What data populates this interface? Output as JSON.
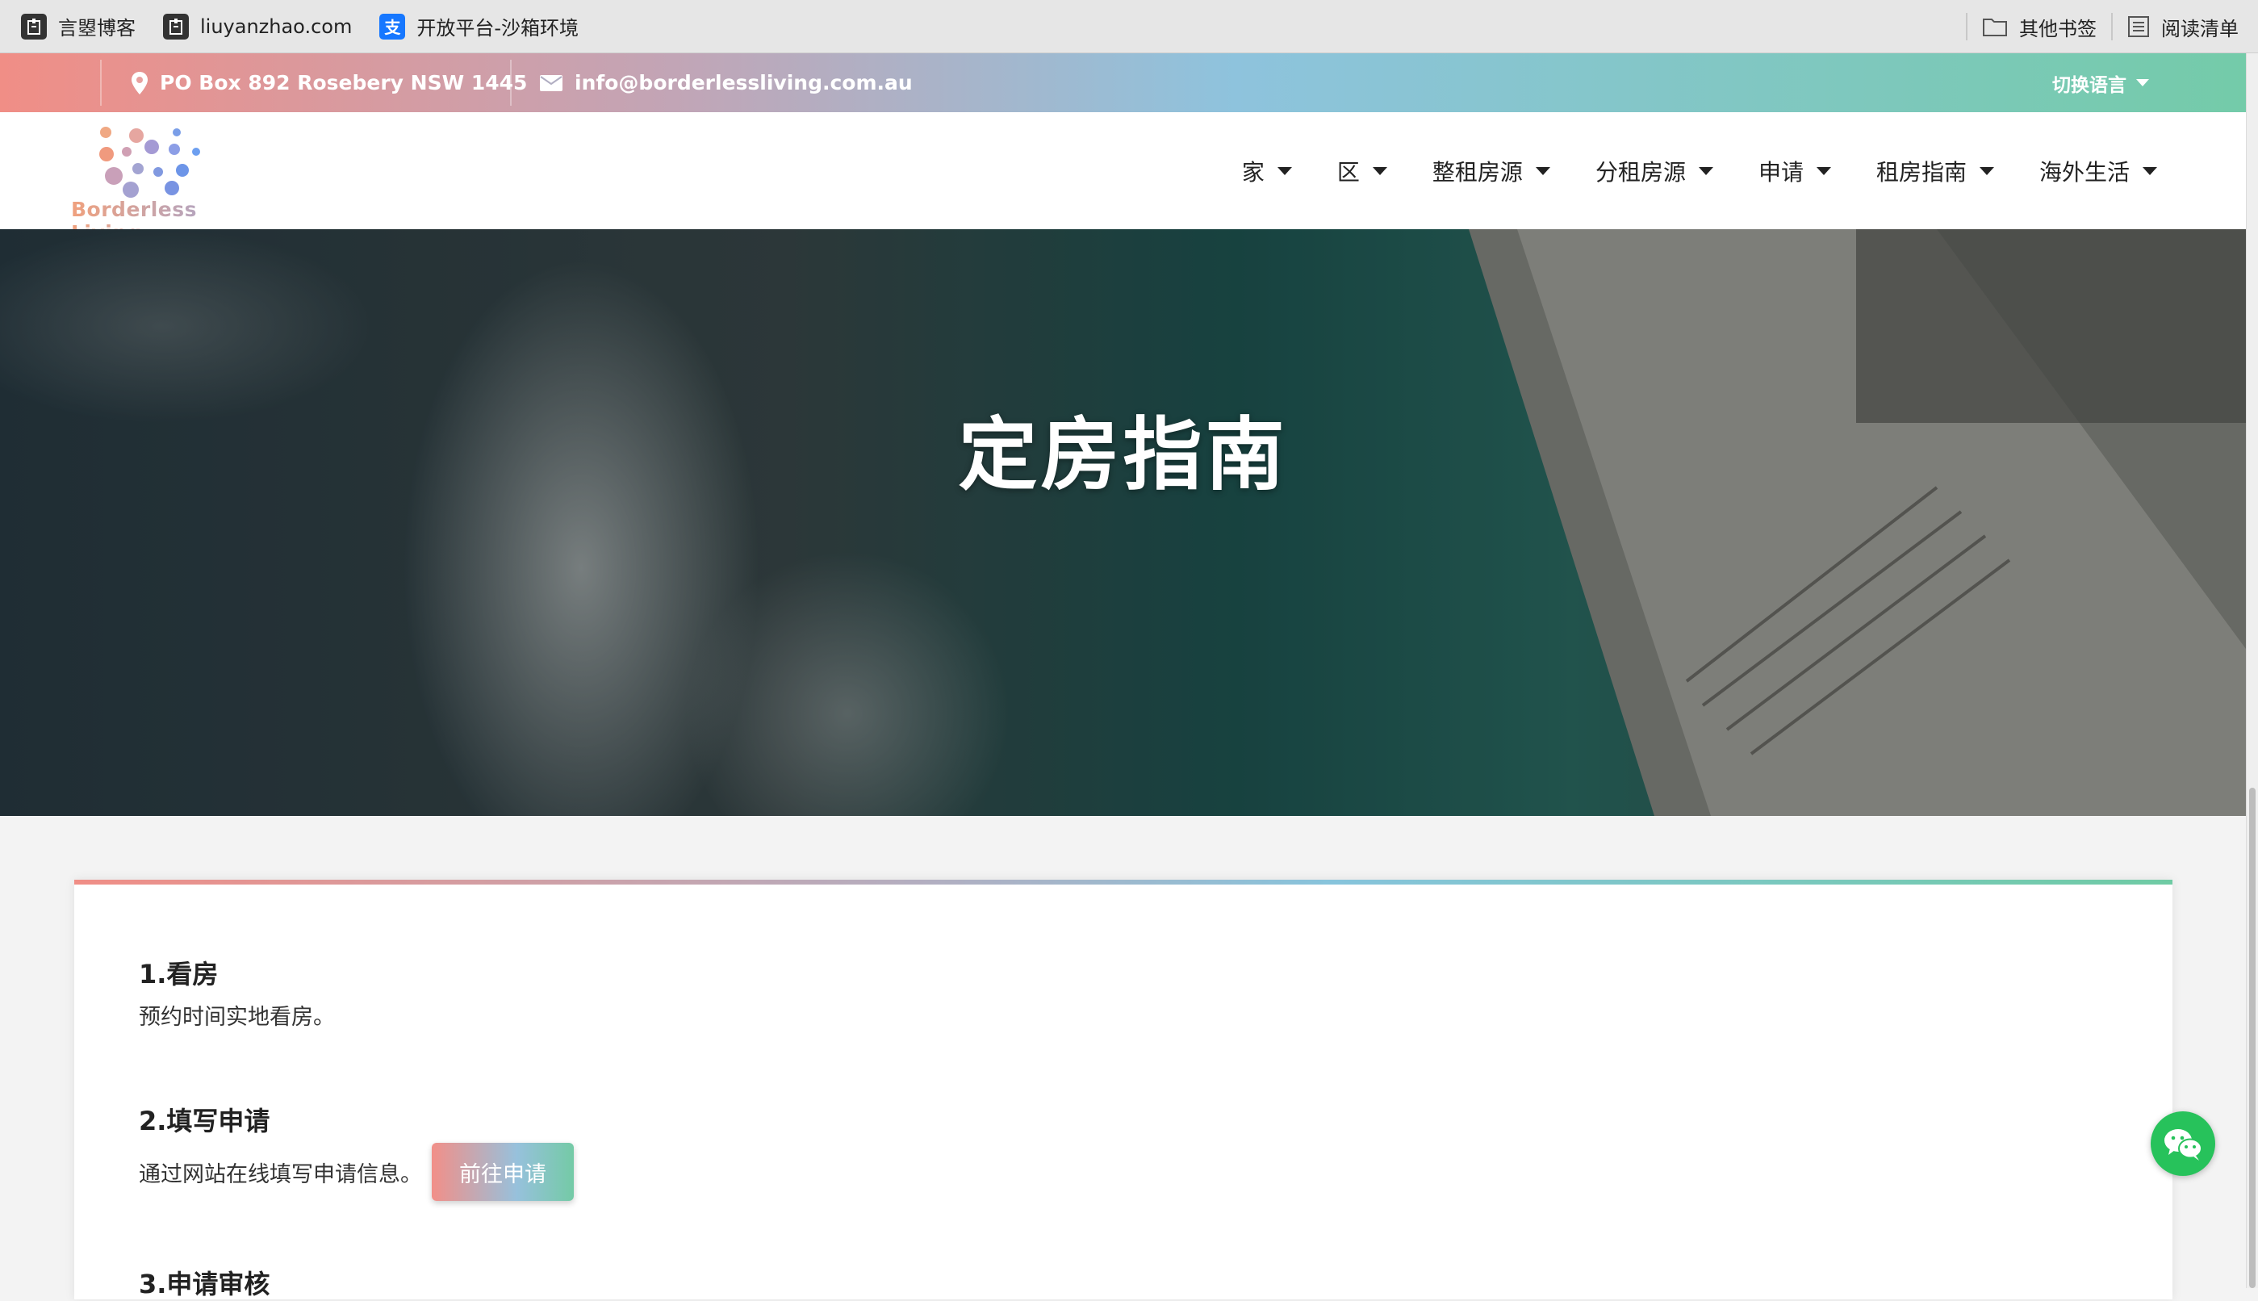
{
  "bookmarks": {
    "items": [
      {
        "label": "言曌博客",
        "icon": "bookmark-site-icon"
      },
      {
        "label": "liuyanzhao.com",
        "icon": "bookmark-site-icon"
      },
      {
        "label": "开放平台-沙箱环境",
        "icon": "alipay-icon"
      }
    ],
    "other_bookmarks": "其他书签",
    "reading_list": "阅读清单"
  },
  "topbar": {
    "address": "PO Box 892 Rosebery NSW 1445",
    "email": "info@borderlessliving.com.au",
    "language": "切换语言"
  },
  "header": {
    "logo_text": "Borderless Living",
    "nav": [
      {
        "label": "家"
      },
      {
        "label": "区"
      },
      {
        "label": "整租房源"
      },
      {
        "label": "分租房源"
      },
      {
        "label": "申请"
      },
      {
        "label": "租房指南"
      },
      {
        "label": "海外生活"
      }
    ]
  },
  "hero": {
    "title": "定房指南"
  },
  "content": {
    "steps": [
      {
        "title": "1.看房",
        "desc": "预约时间实地看房。"
      },
      {
        "title": "2.填写申请",
        "desc": "通过网站在线填写申请信息。",
        "button": "前往申请"
      },
      {
        "title": "3.申请审核"
      }
    ]
  },
  "colors": {
    "gradient_start": "#f08e86",
    "gradient_mid": "#8ec3dd",
    "gradient_end": "#74cba9",
    "wechat_green": "#27c25b"
  }
}
